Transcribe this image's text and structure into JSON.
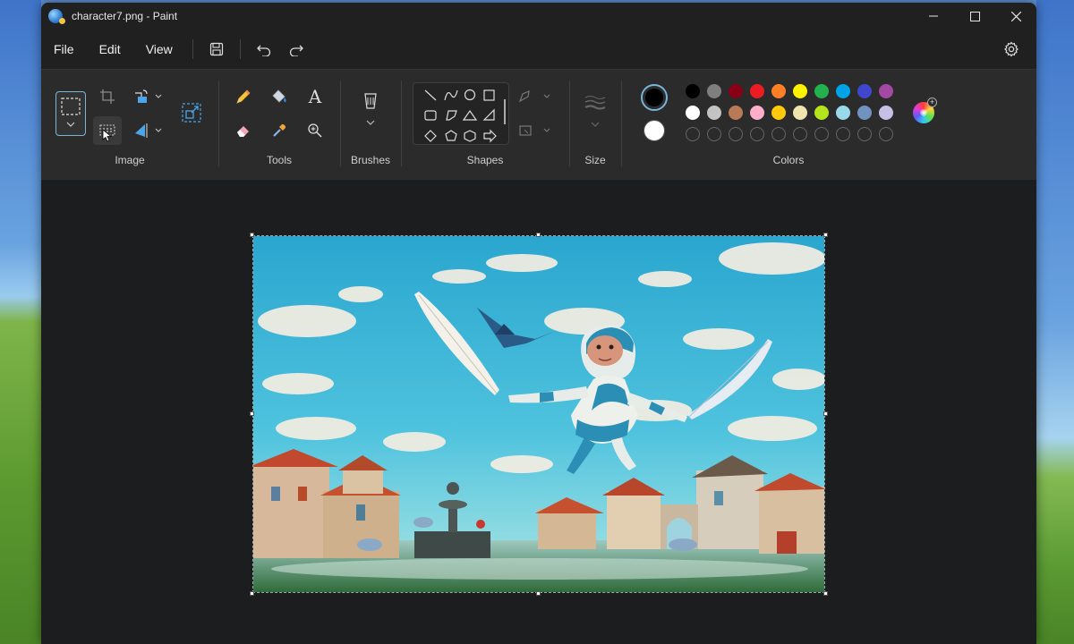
{
  "window": {
    "title": "character7.png - Paint"
  },
  "menu": {
    "items": [
      "File",
      "Edit",
      "View"
    ]
  },
  "ribbon": {
    "groups": {
      "image": "Image",
      "tools": "Tools",
      "brushes": "Brushes",
      "shapes": "Shapes",
      "size": "Size",
      "colors": "Colors"
    },
    "text_tool_glyph": "A"
  },
  "colors": {
    "primary": "#000000",
    "secondary": "#ffffff",
    "palette_row1": [
      "#000000",
      "#7f7f7f",
      "#880015",
      "#ed1c24",
      "#ff7f27",
      "#fff200",
      "#22b14c",
      "#00a2e8",
      "#3f48cc",
      "#a349a4"
    ],
    "palette_row2": [
      "#ffffff",
      "#c3c3c3",
      "#b97a57",
      "#ffaec9",
      "#ffc90e",
      "#efe4b0",
      "#b5e61d",
      "#99d9ea",
      "#7092be",
      "#c8bfe7"
    ],
    "accent": "#0a84ff",
    "canvas_bg": "#1b1d1e",
    "ribbon_bg": "#2b2b2b"
  }
}
